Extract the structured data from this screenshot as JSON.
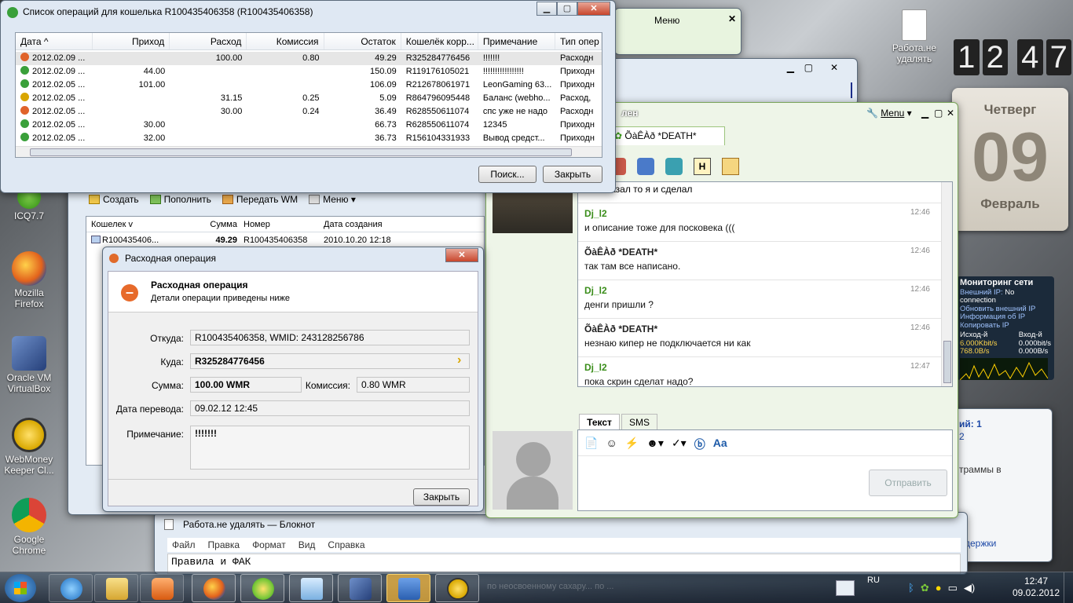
{
  "desktop_icons": [
    {
      "label": "ICQ7.7"
    },
    {
      "label": "Mozilla Firefox"
    },
    {
      "label": "Oracle VM VirtualBox"
    },
    {
      "label": "WebMoney Keeper Cl..."
    },
    {
      "label": "Google Chrome"
    },
    {
      "label": "Работа.не удалять"
    }
  ],
  "clock_gadget": {
    "h1": "1",
    "h2": "2",
    "m1": "4",
    "m2": "7"
  },
  "calendar_gadget": {
    "weekday": "Четверг",
    "day": "09",
    "month": "Февраль"
  },
  "net_monitor": {
    "title": "Мониторинг сети",
    "ext_ip_label": "Внешний IP:",
    "ext_ip_value": "No connection",
    "l1": "Обновить внешний IP",
    "l2": "Информация об IP",
    "l3": "Копировать IP",
    "out_label": "Исход-й",
    "in_label": "Вход-й",
    "out1": "6.000Kbit/s",
    "out2": "768.0B/s",
    "in1": "0.000bit/s",
    "in2": "0.000B/s"
  },
  "ops_window": {
    "title": "Список операций для кошелька R100435406358 (R100435406358)",
    "columns": [
      "Дата ^",
      "Приход",
      "Расход",
      "Комиссия",
      "Остаток",
      "Кошелёк корр...",
      "Примечание",
      "Тип опер"
    ],
    "rows": [
      {
        "date": "2012.02.09 ...",
        "in": "",
        "out": "100.00",
        "fee": "0.80",
        "bal": "49.29",
        "wallet": "R325284776456",
        "note": "!!!!!!!",
        "type": "Расходн",
        "kind": "out"
      },
      {
        "date": "2012.02.09 ...",
        "in": "44.00",
        "out": "",
        "fee": "",
        "bal": "150.09",
        "wallet": "R119176105021",
        "note": "!!!!!!!!!!!!!!!!!",
        "type": "Приходн",
        "kind": "in"
      },
      {
        "date": "2012.02.05 ...",
        "in": "101.00",
        "out": "",
        "fee": "",
        "bal": "106.09",
        "wallet": "R212678061971",
        "note": "LeonGaming 63...",
        "type": "Приходн",
        "kind": "in"
      },
      {
        "date": "2012.02.05 ...",
        "in": "",
        "out": "31.15",
        "fee": "0.25",
        "bal": "5.09",
        "wallet": "R864796095448",
        "note": "Баланс (webho...",
        "type": "Расход,",
        "kind": "inv"
      },
      {
        "date": "2012.02.05 ...",
        "in": "",
        "out": "30.00",
        "fee": "0.24",
        "bal": "36.49",
        "wallet": "R628550611074",
        "note": "спс уже не надо",
        "type": "Расходн",
        "kind": "out"
      },
      {
        "date": "2012.02.05 ...",
        "in": "30.00",
        "out": "",
        "fee": "",
        "bal": "66.73",
        "wallet": "R628550611074",
        "note": "12345",
        "type": "Приходн",
        "kind": "in"
      },
      {
        "date": "2012.02.05 ...",
        "in": "32.00",
        "out": "",
        "fee": "",
        "bal": "36.73",
        "wallet": "R156104331933",
        "note": "Вывод средст...",
        "type": "Приходн",
        "kind": "in"
      }
    ],
    "search_btn": "Поиск...",
    "close_btn": "Закрыть"
  },
  "keeper": {
    "toolbar": {
      "create": "Создать",
      "fund": "Пополнить",
      "send": "Передать WM",
      "menu": "Меню"
    },
    "columns": [
      "Кошелек v",
      "Сумма",
      "Номер",
      "Дата создания"
    ],
    "row": {
      "wallet": "R100435406...",
      "sum": "49.29",
      "num": "R100435406358",
      "date": "2010.10.20 12:18"
    }
  },
  "op_dialog": {
    "title": "Расходная операция",
    "header": "Расходная операция",
    "sub": "Детали операции приведены ниже",
    "from_label": "Откуда:",
    "from": "R100435406358, WMID: 243128256786",
    "to_label": "Куда:",
    "to": "R325284776456",
    "sum_label": "Сумма:",
    "sum": "100.00 WMR",
    "fee_label": "Комиссия:",
    "fee": "0.80 WMR",
    "date_label": "Дата перевода:",
    "date": "09.02.12 12:45",
    "note_label": "Примечание:",
    "note": "!!!!!!!",
    "close_btn": "Закрыть"
  },
  "icq": {
    "title_fragment": "лен",
    "menu_label": "Menu",
    "tab": "ÕàÊÀð *DEATH*",
    "partial_top": "что сказал то я и сделал",
    "messages": [
      {
        "name": "Dj_l2",
        "time": "12:46",
        "text": "и описание тоже для посковека (((",
        "who": "me"
      },
      {
        "name": "ÕàÊÀð *DEATH*",
        "time": "12:46",
        "text": "так там все написано.",
        "who": "other"
      },
      {
        "name": "Dj_l2",
        "time": "12:46",
        "text": "денги пришли ?",
        "who": "me"
      },
      {
        "name": "ÕàÊÀð *DEATH*",
        "time": "12:46",
        "text": "незнаю кипер не подключается ни как",
        "who": "other"
      },
      {
        "name": "Dj_l2",
        "time": "12:47",
        "text": "пока скрин сделат  надо?",
        "who": "me"
      }
    ],
    "tab_text": "Текст",
    "tab_sms": "SMS",
    "send_btn": "Отправить"
  },
  "small_icq": {
    "menu": "Меню"
  },
  "side_frag": {
    "a": "ий: 1",
    "b": "2",
    "c": "траммы в",
    "d": "ддержки"
  },
  "notepad": {
    "title": "Работа.не удалять — Блокнот",
    "menu": [
      "Файл",
      "Правка",
      "Формат",
      "Вид",
      "Справка"
    ],
    "text": "Правила и ФАК"
  },
  "taskbar": {
    "lang": "RU",
    "time": "12:47",
    "date": "09.02.2012",
    "ticker": "по неосвоенному сахару... по ..."
  }
}
